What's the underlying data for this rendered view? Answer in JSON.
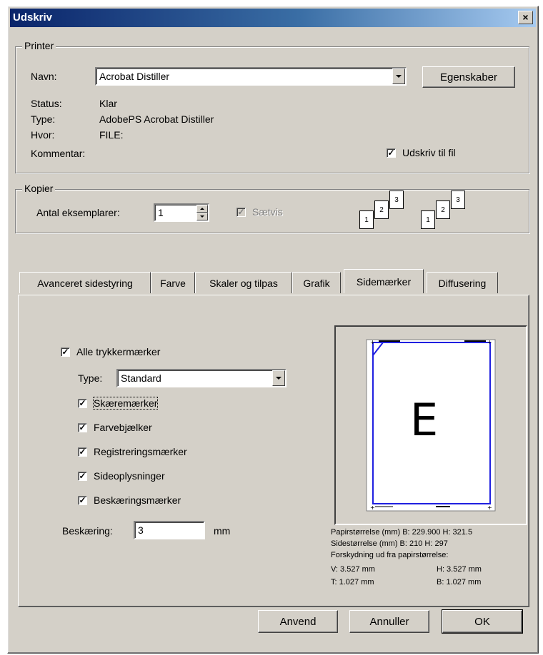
{
  "window": {
    "title": "Udskriv",
    "close_glyph": "×"
  },
  "printer": {
    "group_label": "Printer",
    "name_label": "Navn:",
    "name_value": "Acrobat Distiller",
    "properties_button": "Egenskaber",
    "status_label": "Status:",
    "status_value": "Klar",
    "type_label": "Type:",
    "type_value": "AdobePS Acrobat Distiller",
    "where_label": "Hvor:",
    "where_value": "FILE:",
    "comment_label": "Kommentar:",
    "print_to_file_label": "Udskriv til fil",
    "print_to_file_checked": true
  },
  "copies": {
    "group_label": "Kopier",
    "count_label": "Antal eksemplarer:",
    "count_value": "1",
    "collate_label": "Sætvis",
    "collate_checked": true,
    "collate_enabled": false,
    "page_numbers": [
      "1",
      "2",
      "3"
    ]
  },
  "tabs": [
    {
      "label": "Avanceret sidestyring",
      "active": false
    },
    {
      "label": "Farve",
      "active": false
    },
    {
      "label": "Skaler og tilpas",
      "active": false
    },
    {
      "label": "Grafik",
      "active": false
    },
    {
      "label": "Sidemærker",
      "active": true
    },
    {
      "label": "Diffusering",
      "active": false
    }
  ],
  "sidemarks": {
    "all_marks_label": "Alle trykkermærker",
    "all_marks_checked": true,
    "type_label": "Type:",
    "type_value": "Standard",
    "options": [
      {
        "label": "Skæremærker",
        "checked": true
      },
      {
        "label": "Farvebjælker",
        "checked": true
      },
      {
        "label": "Registreringsmærker",
        "checked": true
      },
      {
        "label": "Sideoplysninger",
        "checked": true
      },
      {
        "label": "Beskæringsmærker",
        "checked": true
      }
    ],
    "bleed_label": "Beskæring:",
    "bleed_value": "3",
    "bleed_unit": "mm"
  },
  "preview": {
    "letter": "E",
    "paper_size": "Papirstørrelse (mm) B: 229.900 H: 321.5",
    "page_size": "Sidestørrelse (mm) B: 210 H: 297",
    "offset_heading": "Forskydning ud fra papirstørrelse:",
    "left": "V: 3.527 mm",
    "right": "H: 3.527 mm",
    "top": "T: 1.027 mm",
    "bottom": "B: 1.027 mm"
  },
  "buttons": {
    "apply": "Anvend",
    "cancel": "Annuller",
    "ok": "OK"
  },
  "colors": {
    "dialog": "#d4d0c8",
    "title_start": "#0a246a",
    "title_end": "#a6caf0",
    "preview_outline": "#2020e0"
  }
}
